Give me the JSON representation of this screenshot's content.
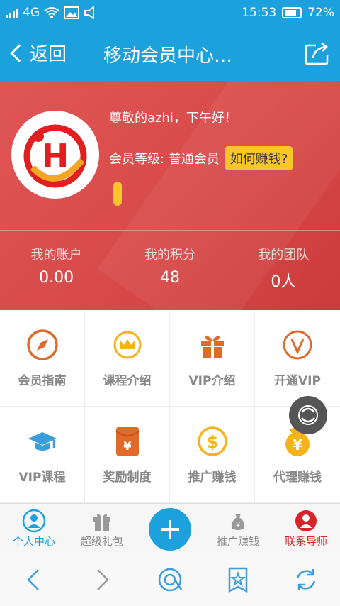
{
  "status_bar": {
    "network": "4G",
    "time": "15:53",
    "battery": "72%"
  },
  "nav": {
    "back_label": "返回",
    "title": "移动会员中心…"
  },
  "profile": {
    "greeting": "尊敬的azhi，下午好！",
    "level_label": "会员等级: 普通会员",
    "earn_button": "如何赚钱?",
    "logo_letter": "H"
  },
  "stats": [
    {
      "label": "我的账户",
      "value": "0.00"
    },
    {
      "label": "我的积分",
      "value": "48"
    },
    {
      "label": "我的团队",
      "value": "0人"
    }
  ],
  "menu": [
    {
      "label": "会员指南",
      "icon": "compass-icon"
    },
    {
      "label": "课程介绍",
      "icon": "crown-icon"
    },
    {
      "label": "VIP介绍",
      "icon": "gift-icon"
    },
    {
      "label": "开通VIP",
      "icon": "vip-icon"
    },
    {
      "label": "VIP课程",
      "icon": "graduation-cap-icon"
    },
    {
      "label": "奖励制度",
      "icon": "red-envelope-icon"
    },
    {
      "label": "推广赚钱",
      "icon": "dollar-coin-icon"
    },
    {
      "label": "代理赚钱",
      "icon": "yen-coin-icon"
    }
  ],
  "tabs": [
    {
      "label": "个人中心"
    },
    {
      "label": "超级礼包"
    },
    {
      "label": "推广赚钱"
    },
    {
      "label": "联系导师"
    }
  ],
  "colors": {
    "primary": "#1da1dc",
    "hero": "#d84a4a",
    "accent": "#f7c62a",
    "orange": "#e06a2a"
  }
}
